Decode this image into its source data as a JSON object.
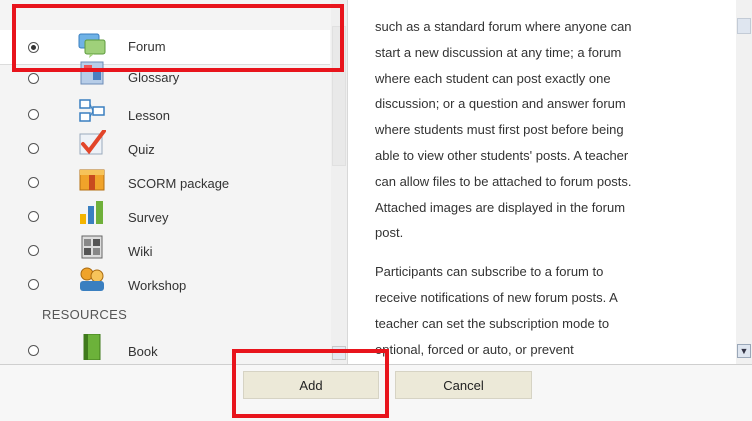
{
  "modules": [
    {
      "label": "Forum",
      "icon": "forum-icon",
      "selected": true
    },
    {
      "label": "Glossary",
      "icon": "glossary-icon",
      "selected": false
    },
    {
      "label": "Lesson",
      "icon": "lesson-icon",
      "selected": false
    },
    {
      "label": "Quiz",
      "icon": "quiz-icon",
      "selected": false
    },
    {
      "label": "SCORM package",
      "icon": "scorm-package-icon",
      "selected": false
    },
    {
      "label": "Survey",
      "icon": "survey-icon",
      "selected": false
    },
    {
      "label": "Wiki",
      "icon": "wiki-icon",
      "selected": false
    },
    {
      "label": "Workshop",
      "icon": "workshop-icon",
      "selected": false
    }
  ],
  "resources_heading": "RESOURCES",
  "resources": [
    {
      "label": "Book",
      "icon": "book-icon",
      "selected": false
    }
  ],
  "description": {
    "paragraph1_lines": [
      "such as a standard forum where anyone can",
      "start a new discussion at any time; a forum",
      "where each student can post exactly one",
      "discussion; or a question and answer forum",
      "where students must first post before being",
      "able to view other students' posts. A teacher",
      "can allow files to be attached to forum posts.",
      "Attached images are displayed in the forum",
      "post."
    ],
    "paragraph2_lines": [
      "Participants can subscribe to a forum to",
      "receive notifications of new forum posts. A",
      "teacher can set the subscription mode to",
      "optional, forced or auto, or prevent"
    ]
  },
  "footer": {
    "add_label": "Add",
    "cancel_label": "Cancel"
  },
  "colors": {
    "highlight": "#e8141c",
    "button_bg": "#ece9d8"
  }
}
